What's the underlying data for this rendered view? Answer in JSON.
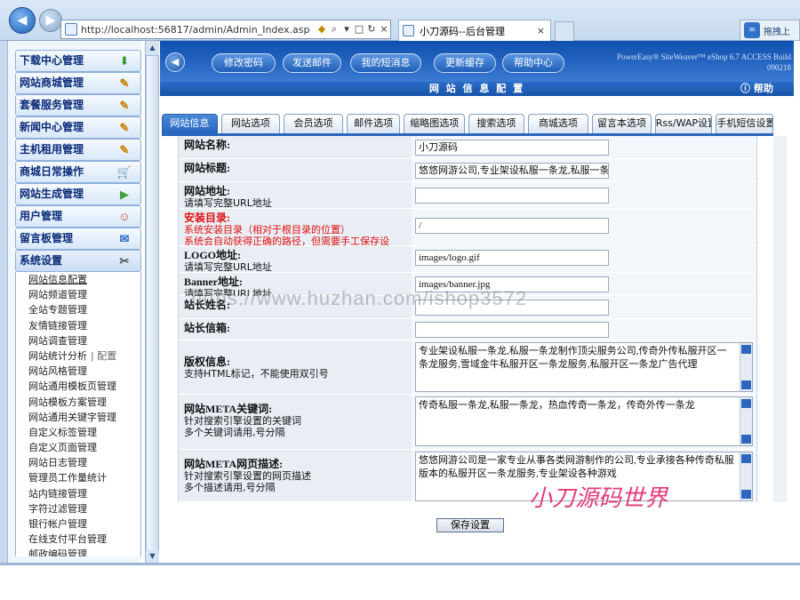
{
  "browser": {
    "url": "http://localhost:56817/admin/Admin_Index.asp",
    "url_bold": "localhost",
    "tab_title": "小刀源码--后台管理",
    "side_button": "拖拽上",
    "close_glyph": "×",
    "back_glyph": "◀",
    "fwd_glyph": "▶"
  },
  "menu": {
    "headers": [
      {
        "label": "下载中心管理",
        "icon": "download-arrow-icon"
      },
      {
        "label": "网站商城管理",
        "icon": "shop-icon"
      },
      {
        "label": "套餐服务管理",
        "icon": "note-edit-icon"
      },
      {
        "label": "新闻中心管理",
        "icon": "note-edit-icon"
      },
      {
        "label": "主机租用管理",
        "icon": "note-edit-icon"
      },
      {
        "label": "商城日常操作",
        "icon": "cart-icon"
      },
      {
        "label": "网站生成管理",
        "icon": "play-icon"
      },
      {
        "label": "用户管理",
        "icon": "user-icon"
      },
      {
        "label": "留言板管理",
        "icon": "guestbook-icon"
      },
      {
        "label": "系统设置",
        "icon": "tools-icon"
      }
    ],
    "sub_items": [
      "网站信息配置",
      "网站频道管理",
      "全站专题管理",
      "友情链接管理",
      "网站调查管理",
      "网站统计分析",
      "网站风格管理",
      "网站通用模板页管理",
      "网站模板方案管理",
      "网站通用关键字管理",
      "自定义标签管理",
      "自定义页面管理",
      "网站日志管理",
      "管理员工作量统计",
      "站内链接管理",
      "字符过滤管理",
      "银行帐户管理",
      "在线支付平台管理",
      "邮政编码管理"
    ],
    "stats_extra": "| 配置"
  },
  "toolbar": {
    "buttons": [
      "修改密码",
      "发送邮件",
      "我的短消息",
      "更新缓存",
      "帮助中心"
    ],
    "brand_line1": "PowerEasy® SiteWeaver™ eShop 6.7 ACCESS Build",
    "brand_line2": "090218"
  },
  "page": {
    "title": "网 站 信 息 配 置",
    "help": "帮助"
  },
  "tabs": [
    "网站信息",
    "网站选项",
    "会员选项",
    "邮件选项",
    "缩略图选项",
    "搜索选项",
    "商城选项",
    "留言本选项",
    "Rss/WAP设置",
    "手机短信设置"
  ],
  "form": {
    "site_name": {
      "label": "网站名称:",
      "value": "小刀源码"
    },
    "site_title": {
      "label": "网站标题:",
      "value": "悠悠网游公司,专业架设私服一条龙,私服一条龙"
    },
    "site_url": {
      "label": "网站地址:",
      "hint": "请填写完整URL地址",
      "value": ""
    },
    "install_dir": {
      "label": "安装目录:",
      "hint1": "系统安装目录（相对于根目录的位置）",
      "hint2": "系统会自动获得正确的路径，但需要手工保存设置。",
      "value": "/"
    },
    "logo": {
      "label": "LOGO地址:",
      "hint": "请填写完整URL地址",
      "value": "images/logo.gif"
    },
    "banner": {
      "label": "Banner地址:",
      "hint": "请填写完整URL地址",
      "value": "images/banner.jpg"
    },
    "webmaster": {
      "label": "站长姓名:",
      "value": ""
    },
    "email": {
      "label": "站长信箱:",
      "value": ""
    },
    "copyright": {
      "label": "版权信息:",
      "hint": "支持HTML标记，不能使用双引号",
      "value": "专业架设私服一条龙,私服一条龙制作顶尖服务公司,传奇外传私服开区一条龙服务,雪域金牛私服开区一条龙服务,私服开区一条龙广告代理"
    },
    "meta_keywords": {
      "label": "网站META关键词:",
      "hint1": "针对搜索引擎设置的关键词",
      "hint2": "多个关键词请用,号分隔",
      "value": "传奇私服一条龙,私服一条龙，热血传奇一条龙，传奇外传一条龙"
    },
    "meta_desc": {
      "label": "网站META网页描述:",
      "hint1": "针对搜索引擎设置的网页描述",
      "hint2": "多个描述请用,号分隔",
      "value": "悠悠网游公司是一家专业从事各类网游制作的公司,专业承接各种传奇私服版本的私服开区一条龙服务,专业架设各种游戏"
    },
    "save_button": "保存设置"
  },
  "overlays": {
    "watermark": "https://www.huzhan.com/ishop3572",
    "signature": "小刀源码世界"
  },
  "colors": {
    "accent": "#1e5fb8",
    "header_text": "#0a2a78",
    "required": "#e01010"
  }
}
